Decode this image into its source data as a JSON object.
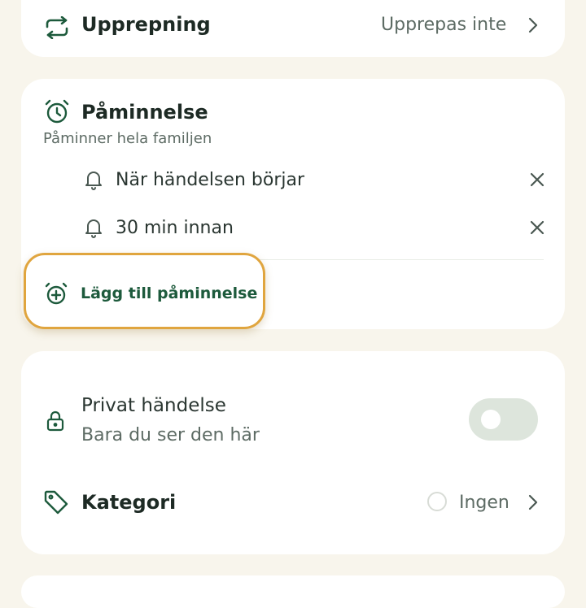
{
  "repeat": {
    "label": "Upprepning",
    "value": "Upprepas inte",
    "icon": "repeat-icon"
  },
  "reminder": {
    "title": "Påminnelse",
    "subtitle": "Påminner hela familjen",
    "icon": "alarm-clock-icon",
    "items": [
      {
        "label": "När händelsen börjar",
        "icon": "bell-icon",
        "remove_icon": "close-icon"
      },
      {
        "label": "30 min innan",
        "icon": "bell-icon",
        "remove_icon": "close-icon"
      }
    ],
    "add_label": "Lägg till påminnelse",
    "add_icon": "alarm-plus-icon"
  },
  "private": {
    "label": "Privat händelse",
    "sublabel": "Bara du ser den här",
    "icon": "lock-icon",
    "enabled": false
  },
  "category": {
    "label": "Kategori",
    "value": "Ingen",
    "icon": "tag-icon"
  },
  "colors": {
    "accent": "#1d5a3c",
    "highlight": "#e0a53f",
    "background": "#f8f5ec",
    "card": "#ffffff"
  }
}
